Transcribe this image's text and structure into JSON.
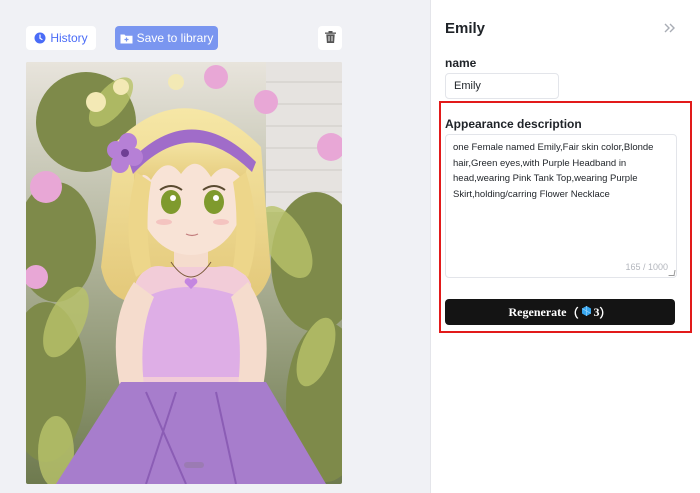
{
  "toolbar": {
    "history_label": "History",
    "save_label": "Save to library"
  },
  "icons": {
    "history": "clock-icon",
    "save": "folder-plus-icon",
    "trash": "trash-icon",
    "collapse": "double-chevron-right-icon",
    "gem": "gem-icon"
  },
  "colors": {
    "accent": "#4a6cf7",
    "save_button": "#7a96f0",
    "regenerate_button": "#141414",
    "highlight_border": "#e21a1a",
    "gem": "#38a7f0"
  },
  "panel": {
    "title": "Emily",
    "name_label": "name",
    "name_value": "Emily",
    "description_label": "Appearance description",
    "description_value": "one Female named Emily,Fair skin color,Blonde hair,Green eyes,with Purple Headband in head,wearing Pink Tank Top,wearing Purple Skirt,holding/carring Flower Necklace",
    "char_count": "165 / 1000",
    "regenerate_label": "Regenerate",
    "regenerate_open": "（",
    "regenerate_cost": "3",
    "regenerate_close": "）"
  }
}
